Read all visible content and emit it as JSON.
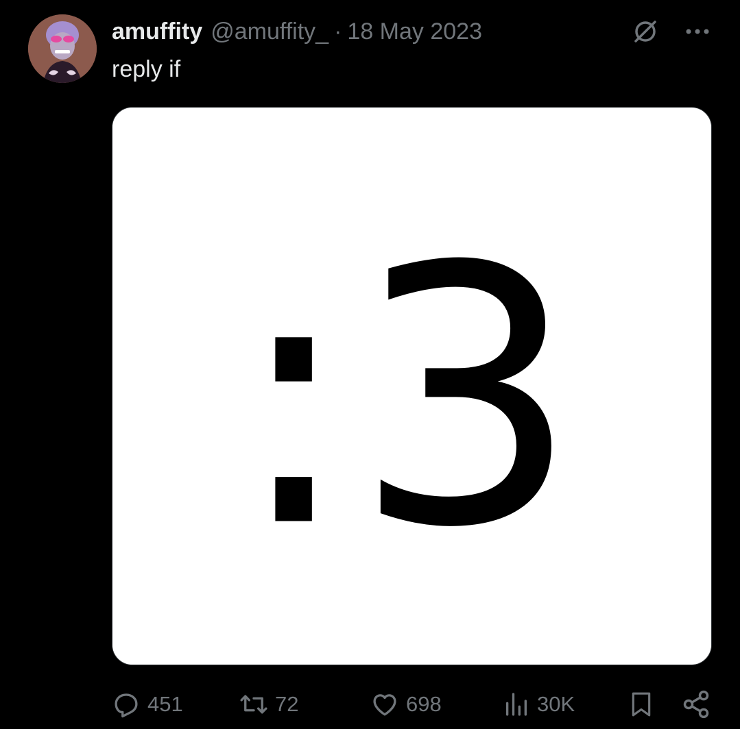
{
  "tweet": {
    "display_name": "amuffity",
    "handle": "@amuffity_",
    "separator": "·",
    "date": "18 May 2023",
    "text": "reply if",
    "media": {
      "image_text": ":3"
    },
    "stats": {
      "replies": "451",
      "retweets": "72",
      "likes": "698",
      "views": "30K"
    }
  },
  "icons": {
    "avatar": "avatar-cartoon-character",
    "grok": "grok-icon",
    "more": "more-options-icon",
    "reply": "reply-icon",
    "retweet": "retweet-icon",
    "like": "heart-icon",
    "views": "views-chart-icon",
    "bookmark": "bookmark-icon",
    "share": "share-icon"
  },
  "colors": {
    "background": "#000000",
    "primary_text": "#e7e9ea",
    "secondary_text": "#71767b",
    "media_background": "#ffffff"
  }
}
